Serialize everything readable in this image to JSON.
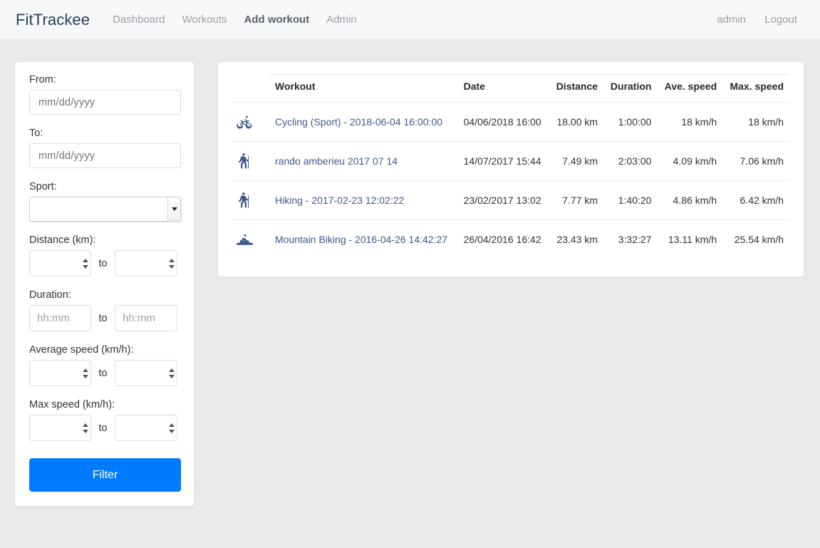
{
  "header": {
    "brand": "FitTrackee",
    "nav": [
      {
        "label": "Dashboard",
        "active": false
      },
      {
        "label": "Workouts",
        "active": false
      },
      {
        "label": "Add workout",
        "active": true
      },
      {
        "label": "Admin",
        "active": false
      }
    ],
    "user": "admin",
    "logout": "Logout"
  },
  "filters": {
    "from_label": "From:",
    "from_value": "",
    "from_placeholder": "mm/dd/yyyy",
    "to_label": "To:",
    "to_value": "",
    "to_placeholder": "mm/dd/yyyy",
    "sport_label": "Sport:",
    "sport_value": "",
    "sport_options": [
      ""
    ],
    "distance_label": "Distance (km):",
    "distance_min": "",
    "distance_max": "",
    "duration_label": "Duration:",
    "duration_min": "",
    "duration_max": "",
    "duration_placeholder": "hh:mm",
    "avg_speed_label": "Average speed (km/h):",
    "avg_speed_min": "",
    "avg_speed_max": "",
    "max_speed_label": "Max speed (km/h):",
    "max_speed_min": "",
    "max_speed_max": "",
    "to_word": "to",
    "filter_button": "Filter",
    "accent_color": "#007bff"
  },
  "table": {
    "columns": [
      "Workout",
      "Date",
      "Distance",
      "Duration",
      "Ave. speed",
      "Max. speed"
    ],
    "rows": [
      {
        "icon": "cycling-icon",
        "workout": "Cycling (Sport) - 2018-06-04 16:00:00",
        "date": "04/06/2018 16:00",
        "distance": "18.00 km",
        "duration": "1:00:00",
        "ave_speed": "18 km/h",
        "max_speed": "18 km/h"
      },
      {
        "icon": "hiking-icon",
        "workout": "rando amberieu 2017 07 14",
        "date": "14/07/2017 15:44",
        "distance": "7.49 km",
        "duration": "2:03:00",
        "ave_speed": "4.09 km/h",
        "max_speed": "7.06 km/h"
      },
      {
        "icon": "hiking-icon",
        "workout": "Hiking - 2017-02-23 12:02:22",
        "date": "23/02/2017 13:02",
        "distance": "7.77 km",
        "duration": "1:40:20",
        "ave_speed": "4.86 km/h",
        "max_speed": "6.42 km/h"
      },
      {
        "icon": "mountain-biking-icon",
        "workout": "Mountain Biking - 2016-04-26 14:42:27",
        "date": "26/04/2016 16:42",
        "distance": "23.43 km",
        "duration": "3:32:27",
        "ave_speed": "13.11 km/h",
        "max_speed": "25.54 km/h"
      }
    ],
    "link_color": "#40578c"
  }
}
